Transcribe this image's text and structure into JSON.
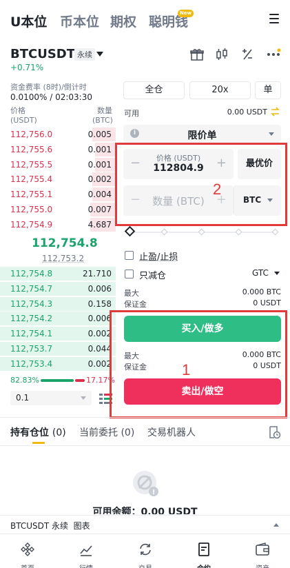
{
  "top_tabs": [
    "U本位",
    "币本位",
    "期权",
    "聪明钱"
  ],
  "new_badge": "New",
  "symbol": {
    "name": "BTCUSDT",
    "tag": "永续",
    "change": "+0.71%"
  },
  "funding": {
    "label": "资金费率 (8时)/倒计时",
    "value": "0.0100% / 02:03:30"
  },
  "orderbook": {
    "price_header": "价格",
    "price_unit": "(USDT)",
    "qty_header": "数量",
    "qty_unit": "(BTC)",
    "asks": [
      {
        "price": "112,756.0",
        "qty": "0.005",
        "depth": 0.2
      },
      {
        "price": "112,755.6",
        "qty": "0.001",
        "depth": 0.18
      },
      {
        "price": "112,755.5",
        "qty": "0.001",
        "depth": 0.18
      },
      {
        "price": "112,755.4",
        "qty": "0.002",
        "depth": 0.2
      },
      {
        "price": "112,755.1",
        "qty": "0.004",
        "depth": 0.2
      },
      {
        "price": "112,755.0",
        "qty": "0.007",
        "depth": 0.22
      },
      {
        "price": "112,754.9",
        "qty": "4.687",
        "depth": 0.22
      }
    ],
    "mid_price": "112,754.8",
    "mark_price": "112,753.2",
    "bids": [
      {
        "price": "112,754.8",
        "qty": "21.710",
        "depth": 1.0
      },
      {
        "price": "112,754.7",
        "qty": "0.006",
        "depth": 1.0
      },
      {
        "price": "112,754.3",
        "qty": "0.158",
        "depth": 1.0
      },
      {
        "price": "112,754.2",
        "qty": "0.006",
        "depth": 1.0
      },
      {
        "price": "112,754.1",
        "qty": "0.002",
        "depth": 1.0
      },
      {
        "price": "112,753.7",
        "qty": "0.044",
        "depth": 1.0
      },
      {
        "price": "112,753.4",
        "qty": "0.002",
        "depth": 1.0
      }
    ],
    "buy_ratio": "82.83%",
    "sell_ratio": "17.17%",
    "precision": "0.1"
  },
  "order_panel": {
    "margin_mode": "全仓",
    "leverage": "20x",
    "position_mode": "单",
    "available_label": "可用",
    "available_value": "0.00 USDT",
    "order_type": "限价单",
    "price_label": "价格 (USDT)",
    "price_value": "112804.9",
    "best_price": "最优价",
    "qty_placeholder": "数量 (BTC)",
    "qty_unit": "BTC",
    "tpsl_label": "止盈/止损",
    "reduce_only_label": "只减仓",
    "tif": "GTC",
    "buy": {
      "max_label": "最大",
      "max_value": "0.000 BTC",
      "margin_label": "保证金",
      "margin_value": "0 USDT",
      "button": "买入/做多"
    },
    "sell": {
      "max_label": "最大",
      "max_value": "0.000 BTC",
      "margin_label": "保证金",
      "margin_value": "0 USDT",
      "button": "卖出/做空"
    }
  },
  "annotations": {
    "one": "1",
    "two": "2"
  },
  "position_tabs": [
    {
      "label": "持有仓位",
      "count": "(0)"
    },
    {
      "label": "当前委托",
      "count": "(0)"
    },
    {
      "label": "交易机器人",
      "count": ""
    }
  ],
  "available_balance": "可用余额：0.00 USDT",
  "chart_bar": {
    "label": "BTCUSDT 永续  图表"
  },
  "bottom_nav": [
    "首页",
    "行情",
    "交易",
    "合约",
    "资产"
  ],
  "colors": {
    "green": "#2ebd85",
    "red": "#ef2f5c",
    "accent": "#f0b90b"
  }
}
